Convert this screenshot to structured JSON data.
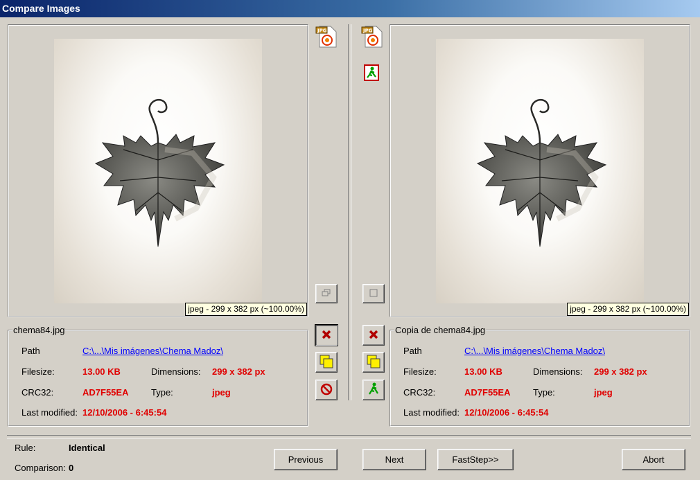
{
  "window": {
    "title": "Compare Images"
  },
  "left": {
    "image_info": "jpeg - 299 x 382 px (~100.00%)",
    "file_name": "chema84.jpg",
    "path_label": "Path",
    "path_value": "C:\\...\\Mis imágenes\\Chema Madoz\\",
    "filesize_label": "Filesize:",
    "filesize_value": "13.00 KB",
    "dimensions_label": "Dimensions:",
    "dimensions_value": "299 x 382 px",
    "crc_label": "CRC32:",
    "crc_value": "AD7F55EA",
    "type_label": "Type:",
    "type_value": "jpeg",
    "modified_label": "Last modified:",
    "modified_value": "12/10/2006 - 6:45:54"
  },
  "right": {
    "image_info": "jpeg - 299 x 382 px (~100.00%)",
    "file_name": "Copia de chema84.jpg",
    "path_label": "Path",
    "path_value": "C:\\...\\Mis imágenes\\Chema Madoz\\",
    "filesize_label": "Filesize:",
    "filesize_value": "13.00 KB",
    "dimensions_label": "Dimensions:",
    "dimensions_value": "299 x 382 px",
    "crc_label": "CRC32:",
    "crc_value": "AD7F55EA",
    "type_label": "Type:",
    "type_value": "jpeg",
    "modified_label": "Last modified:",
    "modified_value": "12/10/2006 - 6:45:54"
  },
  "footer": {
    "rule_label": "Rule:",
    "rule_value": "Identical",
    "comparison_label": "Comparison:",
    "comparison_value": "0"
  },
  "buttons": {
    "previous": "Previous",
    "next": "Next",
    "faststep": "FastStep>>",
    "abort": "Abort"
  },
  "icons": {
    "jpg_file": "jpg-file-icon",
    "exit": "exit-runner-icon",
    "delete": "delete-x-icon",
    "copy": "copy-notes-icon",
    "forbid": "no-entry-icon",
    "move": "green-runner-icon",
    "restore": "restore-window-icon",
    "maximize": "maximize-window-icon"
  },
  "colors": {
    "accent_red": "#e00000",
    "link_blue": "#0000ff",
    "title_blue": "#0a246a"
  }
}
